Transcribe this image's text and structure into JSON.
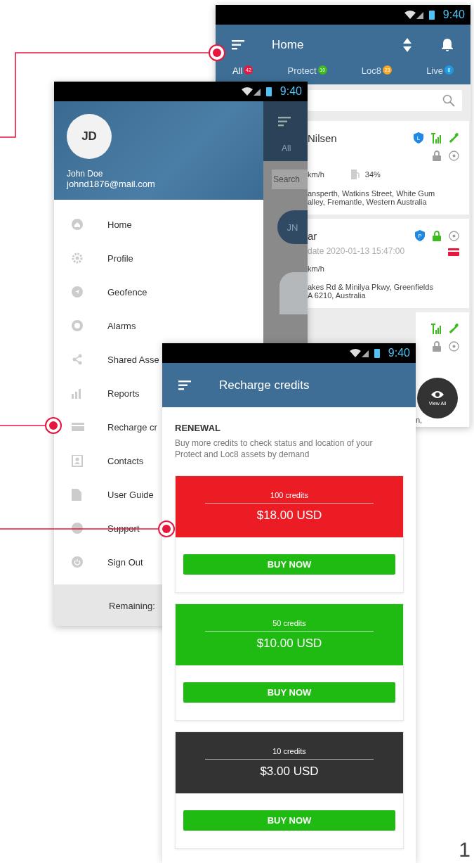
{
  "home_screen": {
    "status_bar": {
      "time": "9:40"
    },
    "title": "Home",
    "tabs": [
      {
        "label": "All",
        "count": "42",
        "color": "#e5173f",
        "selected": true
      },
      {
        "label": "Protect",
        "count": "10",
        "color": "#3cba1e",
        "selected": false
      },
      {
        "label": "Loc8",
        "count": "23",
        "color": "#f5a623",
        "selected": false
      },
      {
        "label": "Live",
        "count": "8",
        "color": "#1e9be5",
        "selected": false
      }
    ],
    "assets": [
      {
        "name": "Nilsen",
        "speed": "km/h",
        "fuel": "34%",
        "address_lines": [
          "ansperth, Watkins Street, White Gum",
          "alley, Fremantle, Western Australia"
        ],
        "icon_rows": [
          [
            {
              "kind": "shield",
              "letter": "L",
              "color": "#1e88e5"
            },
            {
              "kind": "signal",
              "color": "#3cba1e"
            },
            {
              "kind": "satellite",
              "color": "#3cba1e"
            }
          ],
          [
            {
              "kind": "lock",
              "color": "#9e9e9e"
            },
            {
              "kind": "target",
              "color": "#9e9e9e"
            }
          ]
        ]
      },
      {
        "name": "ar",
        "subtitle": "date 2020-01-13 15:47:00",
        "speed": "km/h",
        "address_lines": [
          "akes Rd & Minilya Pkwy, Greenfields",
          "A 6210, Australia"
        ],
        "icon_rows": [
          [
            {
              "kind": "shield",
              "letter": "P",
              "color": "#1e88e5"
            },
            {
              "kind": "lock",
              "color": "#3cba1e"
            },
            {
              "kind": "target",
              "color": "#9e9e9e"
            }
          ],
          [
            {
              "kind": "card",
              "color": "#e5173f"
            }
          ]
        ]
      },
      {
        "address_lines": [
          "n,"
        ],
        "icon_rows": [
          [
            {
              "kind": "signal",
              "color": "#3cba1e"
            },
            {
              "kind": "satellite",
              "color": "#3cba1e"
            }
          ],
          [
            {
              "kind": "lock",
              "color": "#9e9e9e"
            },
            {
              "kind": "target",
              "color": "#9e9e9e"
            }
          ]
        ]
      }
    ],
    "fab": {
      "label": "View All"
    }
  },
  "drawer_screen": {
    "status_bar": {
      "time": "9:40"
    },
    "avatar_initials": "JD",
    "user_name": "John Doe",
    "email": "johnd1876@mail.com",
    "menu": [
      {
        "label": "Home"
      },
      {
        "label": "Profile"
      },
      {
        "label": "Geofence"
      },
      {
        "label": "Alarms"
      },
      {
        "label": "Shared Asse"
      },
      {
        "label": "Reports"
      },
      {
        "label": "Recharge cr"
      },
      {
        "label": "Contacts"
      },
      {
        "label": "User Guide"
      },
      {
        "label": "Support"
      },
      {
        "label": "Sign Out"
      }
    ],
    "remaining": "Remaining:",
    "background_screen": {
      "tab": "All",
      "search_placeholder": "Search",
      "avatar_initials": "JN"
    }
  },
  "recharge_screen": {
    "status_bar": {
      "time": "9:40"
    },
    "title": "Recharge credits",
    "section_title": "RENEWAL",
    "description": "Buy more credits to check status and location of your Protect and Loc8 assets by demand",
    "packages": [
      {
        "credits": "100 credits",
        "price": "$18.00 USD",
        "color": "#ec1c24",
        "button": "BUY NOW"
      },
      {
        "credits": "50 credits",
        "price": "$10.00 USD",
        "color": "#1fbb12",
        "button": "BUY NOW"
      },
      {
        "credits": "10 credits",
        "price": "$3.00 USD",
        "color": "#333333",
        "button": "BUY NOW"
      }
    ]
  },
  "page_number": "1"
}
